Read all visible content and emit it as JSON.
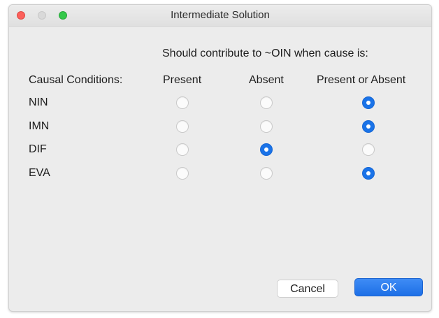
{
  "window": {
    "title": "Intermediate Solution"
  },
  "instruction": "Should contribute to ~OIN when cause is:",
  "headers": {
    "causal": "Causal Conditions:",
    "present": "Present",
    "absent": "Absent",
    "present_or_absent": "Present or Absent"
  },
  "conditions": [
    {
      "name": "NIN",
      "selected": "Present or Absent"
    },
    {
      "name": "IMN",
      "selected": "Present or Absent"
    },
    {
      "name": "DIF",
      "selected": "Absent"
    },
    {
      "name": "EVA",
      "selected": "Present or Absent"
    }
  ],
  "buttons": {
    "cancel": "Cancel",
    "ok": "OK"
  },
  "colors": {
    "accent": "#1a73e8",
    "close": "#fc605b",
    "zoom": "#34c84a"
  }
}
